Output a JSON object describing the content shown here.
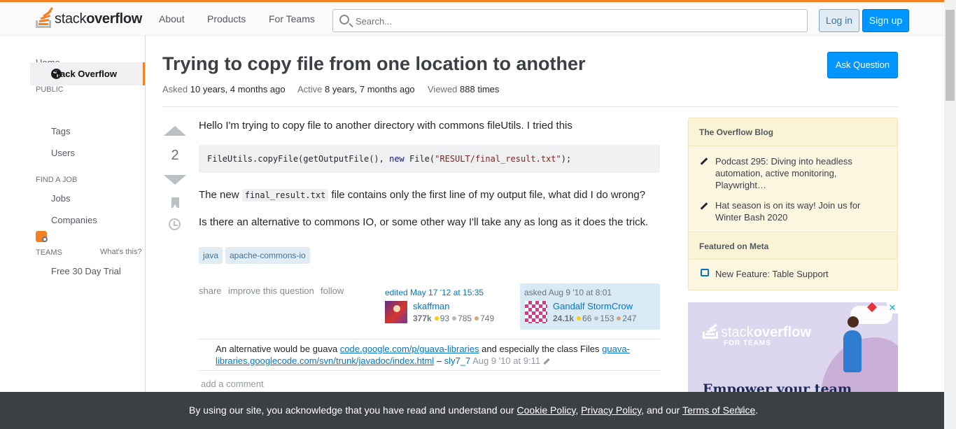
{
  "header": {
    "logo_text_light": "stack",
    "logo_text_bold": "overflow",
    "nav": [
      "About",
      "Products",
      "For Teams"
    ],
    "search_placeholder": "Search...",
    "login": "Log in",
    "signup": "Sign up"
  },
  "sidebar": {
    "home": "Home",
    "public_heading": "PUBLIC",
    "stack_overflow": "Stack Overflow",
    "tags": "Tags",
    "users": "Users",
    "find_job_heading": "FIND A JOB",
    "jobs": "Jobs",
    "companies": "Companies",
    "teams_heading": "TEAMS",
    "whats_this": "What's this?",
    "free_trial": "Free 30 Day Trial"
  },
  "question": {
    "title": "Trying to copy file from one location to another",
    "ask_button": "Ask Question",
    "meta": {
      "asked_label": "Asked",
      "asked_value": "10 years, 4 months ago",
      "active_label": "Active",
      "active_value": "8 years, 7 months ago",
      "viewed_label": "Viewed",
      "viewed_value": "888 times"
    },
    "votes": "2",
    "body_1": "Hello I'm trying to copy file to another directory with commons fileUtils. I tried this",
    "code": {
      "part1": "FileUtils.copyFile(getOutputFile(), ",
      "kw": "new",
      "part2": " File(",
      "str": "\"RESULT/final_result.txt\"",
      "part3": ");"
    },
    "body_2_pre": "The new ",
    "body_2_code": "final_result.txt",
    "body_2_post": " file contains only the first line of my output file, what did I do wrong?",
    "body_3": "Is there an alternative to commons IO, or some other way I'll take any as long as it does the trick.",
    "tags": [
      "java",
      "apache-commons-io"
    ],
    "menu": [
      "share",
      "improve this question",
      "follow"
    ],
    "edited": {
      "action": "edited May 17 '12 at 15:35",
      "user": "skaffman",
      "rep": "377k",
      "gold": "93",
      "silver": "785",
      "bronze": "749"
    },
    "asked": {
      "action": "asked Aug 9 '10 at 8:01",
      "user": "Gandalf StormCrow",
      "rep": "24.1k",
      "gold": "66",
      "silver": "153",
      "bronze": "247"
    },
    "comment": {
      "text1": "An alternative would be guava ",
      "link1": "code.google.com/p/guava-libraries",
      "text2": " and especially the class Files ",
      "link2": "guava-libraries.googlecode.com/svn/trunk/javadoc/index.html",
      "dash": " – ",
      "user": "sly7_7",
      "date": "Aug 9 '10 at 9:11"
    },
    "add_comment": "add a comment"
  },
  "blog": {
    "heading": "The Overflow Blog",
    "items": [
      "Podcast 295: Diving into headless automation, active monitoring, Playwright…",
      "Hat season is on its way! Join us for Winter Bash 2020"
    ],
    "meta_heading": "Featured on Meta",
    "meta_items": [
      "New Feature: Table Support"
    ]
  },
  "ad": {
    "brand_light": "stack",
    "brand_bold": "overflow",
    "sub": "FOR TEAMS",
    "headline": "Empower your team",
    "close": "✕"
  },
  "cookie": {
    "text1": "By using our site, you acknowledge that you have read and understand our ",
    "cookie_policy": "Cookie Policy",
    "sep1": ", ",
    "privacy_policy": "Privacy Policy",
    "text2": ", and our ",
    "terms": "Terms of Service",
    "text3": ".",
    "close": "✕"
  },
  "colors": {
    "accent": "#f48024",
    "primary_button": "#0095ff",
    "link": "#0077cc",
    "tag_bg": "#e1ecf4"
  }
}
